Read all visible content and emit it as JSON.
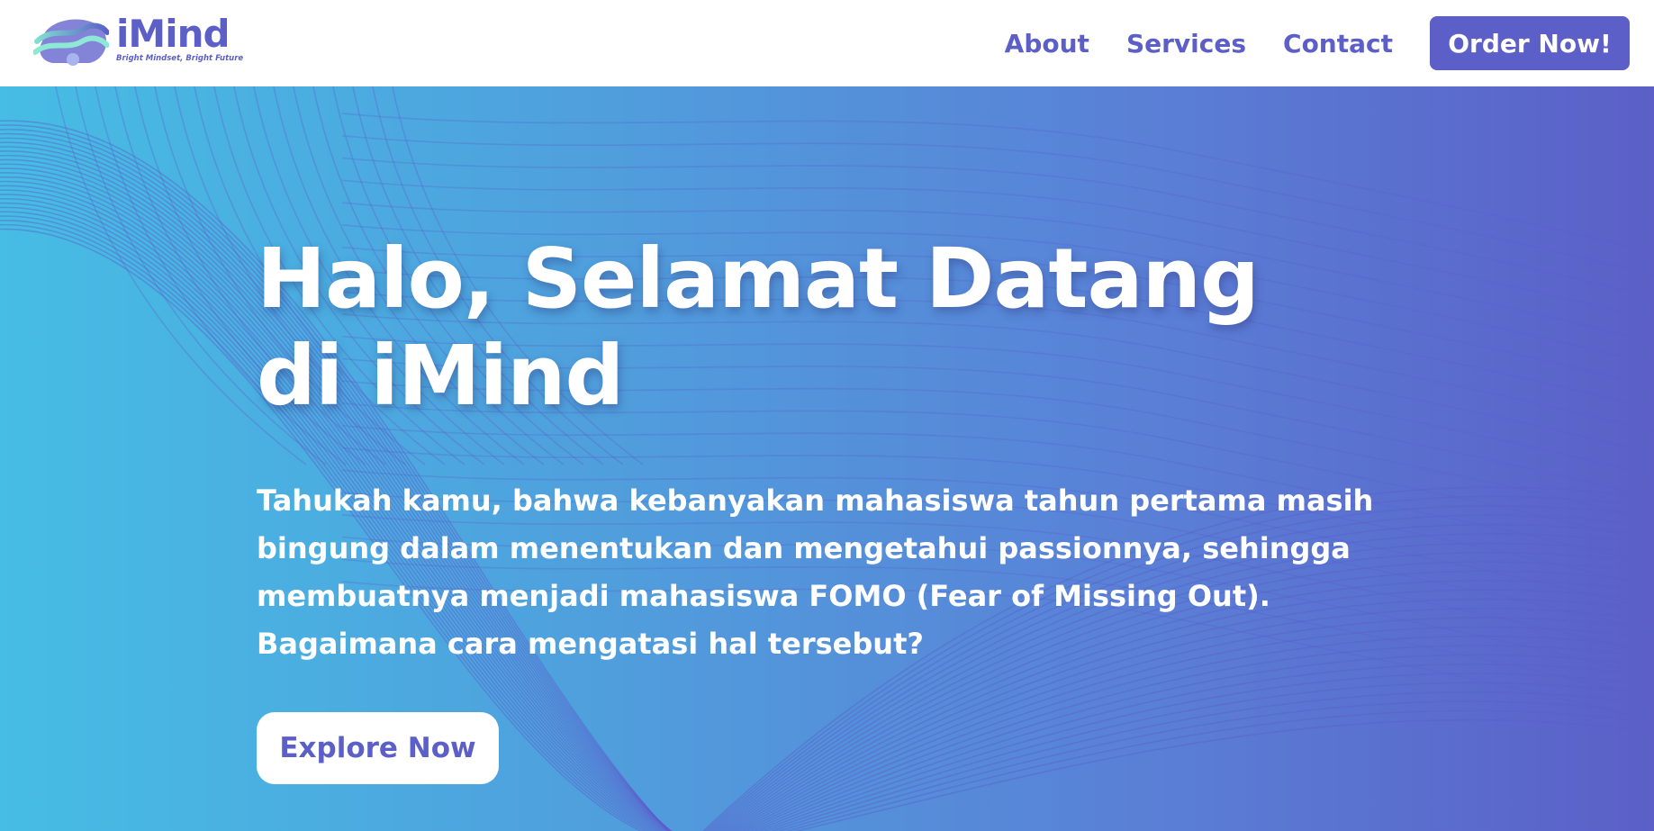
{
  "brand": {
    "name": "iMind",
    "tagline": "Bright Mindset, Bright Future",
    "logo_icon": "waves-brain-icon",
    "primary_color": "#5b5fc7",
    "gradient_start": "#46bde4",
    "gradient_end": "#5b5fc7"
  },
  "nav": {
    "links": [
      {
        "label": "About"
      },
      {
        "label": "Services"
      },
      {
        "label": "Contact"
      }
    ],
    "cta_label": "Order Now!"
  },
  "hero": {
    "title_lines": [
      "Halo, Selamat Datang",
      "di iMind"
    ],
    "description_lines": [
      "Tahukah kamu, bahwa kebanyakan mahasiswa tahun pertama masih",
      "bingung dalam menentukan dan mengetahui passionnya, sehingga",
      "membuatnya menjadi mahasiswa FOMO (Fear of Missing Out).",
      "Bagaimana cara mengatasi hal tersebut?"
    ],
    "cta_label": "Explore Now"
  }
}
